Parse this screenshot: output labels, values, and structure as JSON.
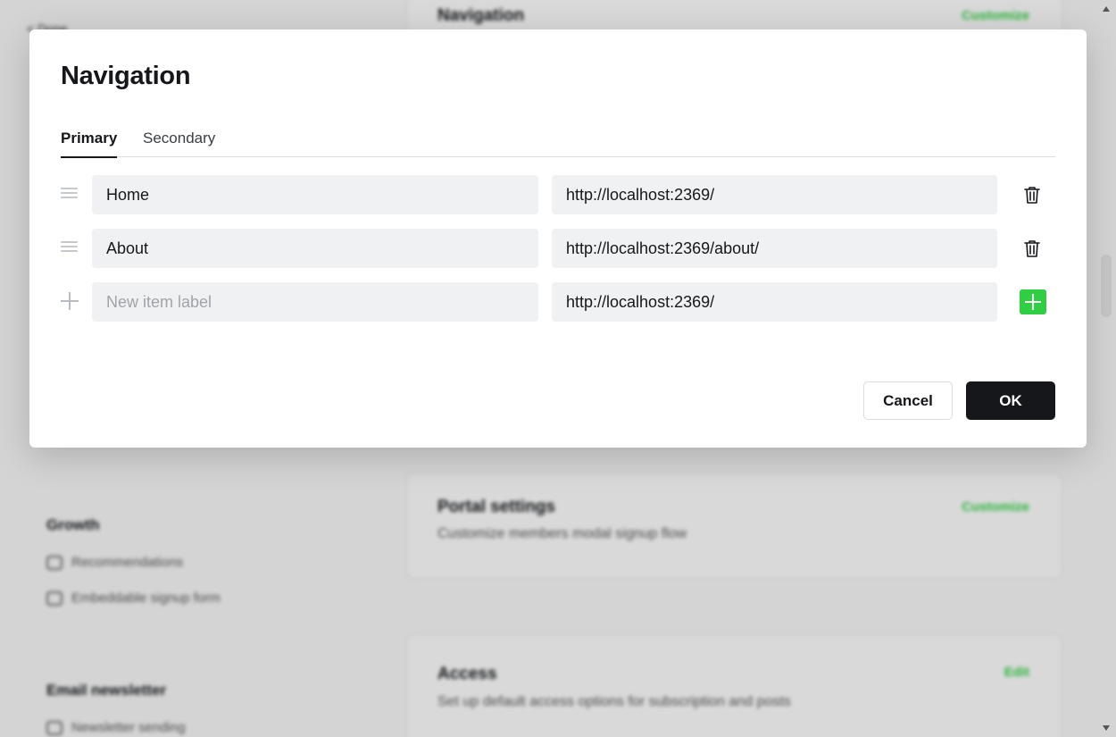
{
  "background": {
    "back_label": "< Done",
    "growth": {
      "title": "Growth",
      "items": [
        "Recommendations",
        "Embeddable signup form"
      ]
    },
    "email": {
      "title": "Email newsletter",
      "items": [
        "Newsletter sending"
      ]
    },
    "cards": [
      {
        "title": "Navigation",
        "description": "",
        "action": "Customize"
      },
      {
        "title": "Portal settings",
        "description": "Customize members modal signup flow",
        "action": "Customize"
      },
      {
        "title": "Access",
        "description": "Set up default access options for subscription and posts",
        "action": "Edit"
      }
    ]
  },
  "modal": {
    "title": "Navigation",
    "tabs": [
      {
        "label": "Primary",
        "active": true
      },
      {
        "label": "Secondary",
        "active": false
      }
    ],
    "items": [
      {
        "label": "Home",
        "url": "http://localhost:2369/"
      },
      {
        "label": "About",
        "url": "http://localhost:2369/about/"
      }
    ],
    "new_item": {
      "label_value": "",
      "label_placeholder": "New item label",
      "url_value": "http://localhost:2369/"
    },
    "cancel_label": "Cancel",
    "ok_label": "OK"
  },
  "colors": {
    "accent_green": "#30cf43",
    "primary_dark": "#15171a",
    "field_bg": "#f0f1f2"
  }
}
